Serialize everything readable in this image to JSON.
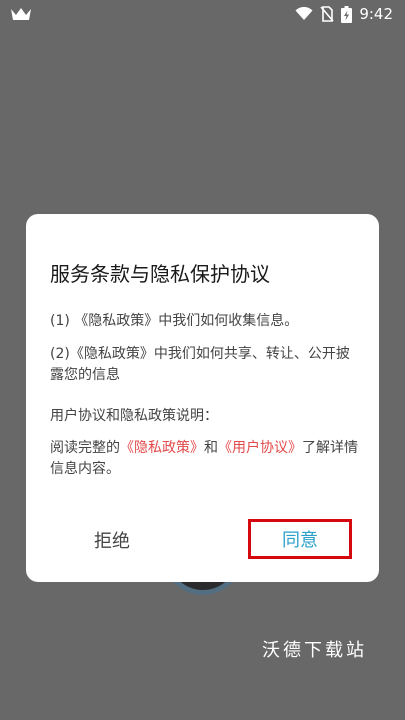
{
  "status_bar": {
    "time": "9:42",
    "icons": [
      "app-crown-icon",
      "wifi-icon",
      "no-sim-icon",
      "battery-icon"
    ]
  },
  "dialog": {
    "title": "服务条款与隐私保护协议",
    "item1": "(1) 《隐私政策》中我们如何收集信息。",
    "item2": "(2)《隐私政策》中我们如何共享、转让、公开披露您的信息",
    "note_label": "用户协议和隐私政策说明：",
    "read_prefix": "阅读完整的",
    "privacy_link": "《隐私政策》",
    "and_text": "和",
    "agreement_link": "《用户协议》",
    "read_suffix": "了解详情信息内容。",
    "reject_label": "拒绝",
    "agree_label": "同意"
  },
  "watermark": "沃德下载站",
  "colors": {
    "backdrop": "#686868",
    "link": "#e34a4a",
    "agree_text": "#29a0c9",
    "highlight_box": "#d4080e"
  }
}
